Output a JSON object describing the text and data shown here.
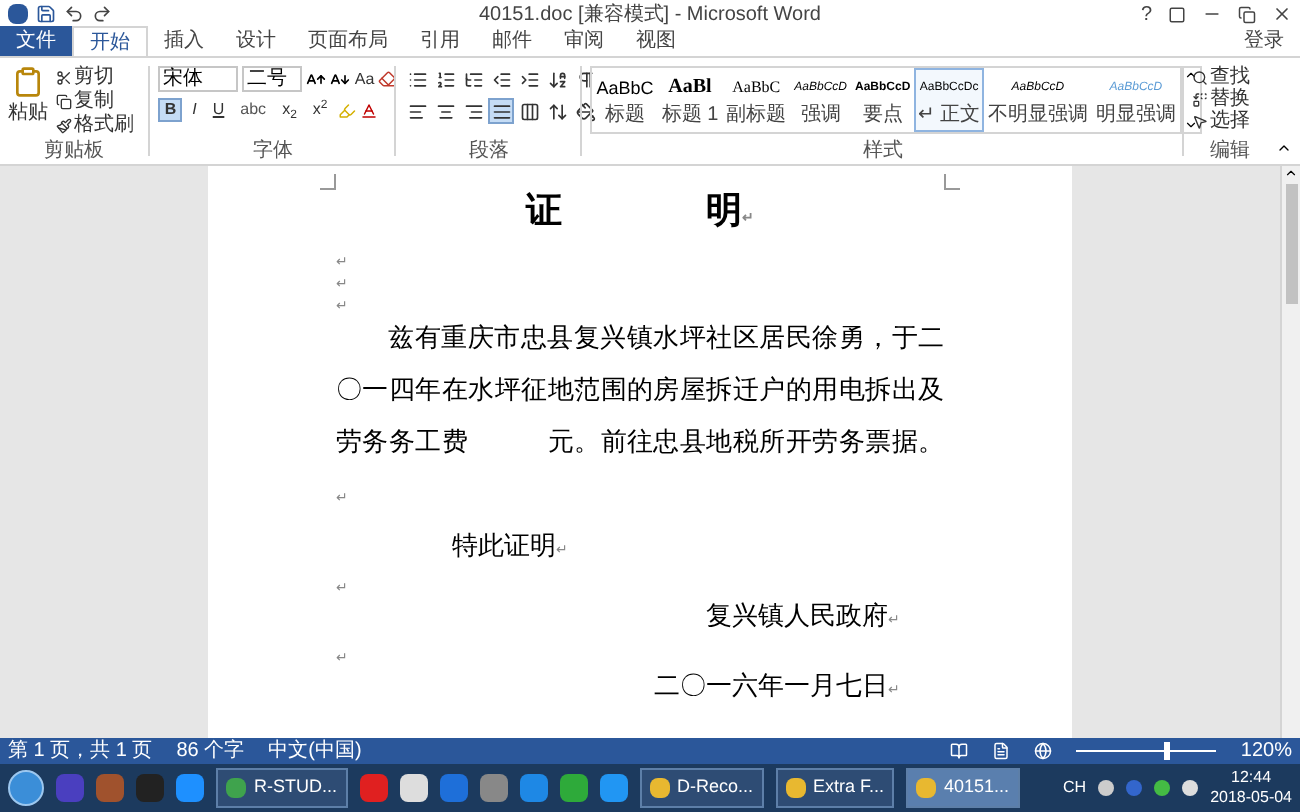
{
  "window": {
    "title": "40151.doc [兼容模式] - Microsoft Word",
    "help": "?",
    "signin": "登录"
  },
  "tabs": [
    {
      "label": "文件",
      "kind": "file",
      "selected": false
    },
    {
      "label": "开始",
      "kind": "tab",
      "selected": true
    },
    {
      "label": "插入",
      "kind": "tab",
      "selected": false
    },
    {
      "label": "设计",
      "kind": "tab",
      "selected": false
    },
    {
      "label": "页面布局",
      "kind": "tab",
      "selected": false
    },
    {
      "label": "引用",
      "kind": "tab",
      "selected": false
    },
    {
      "label": "邮件",
      "kind": "tab",
      "selected": false
    },
    {
      "label": "审阅",
      "kind": "tab",
      "selected": false
    },
    {
      "label": "视图",
      "kind": "tab",
      "selected": false
    }
  ],
  "clipboard": {
    "paste": "粘贴",
    "items": [
      "剪切",
      "复制",
      "格式刷"
    ],
    "label": "剪贴板"
  },
  "font": {
    "family": "宋体",
    "size": "二号",
    "change_case": "Aa",
    "formats": [
      {
        "label": "B",
        "kind": "bold",
        "selected": true
      },
      {
        "label": "I",
        "kind": "italic",
        "selected": false
      },
      {
        "label": "U",
        "kind": "underline",
        "selected": false
      },
      {
        "label": "abc",
        "kind": "strike",
        "selected": false
      },
      {
        "label": "x$_{2}$",
        "kind": "plain",
        "selected": false
      },
      {
        "label": "x$^{2}$",
        "kind": "plain",
        "selected": false
      }
    ],
    "label": "字体"
  },
  "paragraph": {
    "alignment": [
      {
        "kind": "left",
        "selected": false
      },
      {
        "kind": "center",
        "selected": false
      },
      {
        "kind": "right",
        "selected": false
      },
      {
        "kind": "justify",
        "selected": true
      },
      {
        "kind": "distribute",
        "selected": false
      }
    ],
    "label": "段落"
  },
  "styles": {
    "items": [
      {
        "sample": "AaBbC",
        "label": "标题",
        "kind": "title",
        "selected": false
      },
      {
        "sample": "AaBl",
        "label": "标题 1",
        "kind": "heading",
        "selected": false
      },
      {
        "sample": "AaBbC",
        "label": "副标题",
        "kind": "subtitle",
        "selected": false
      },
      {
        "sample": "AaBbCcD",
        "label": "强调",
        "kind": "emphasis",
        "selected": false
      },
      {
        "sample": "AaBbCcD",
        "label": "要点",
        "kind": "strong",
        "selected": false
      },
      {
        "sample": "AaBbCcDc",
        "label": "↵ 正文",
        "kind": "normal",
        "selected": true
      },
      {
        "sample": "AaBbCcD",
        "label": "不明显强调",
        "kind": "emphasis",
        "selected": false
      },
      {
        "sample": "AaBbCcD",
        "label": "明显强调",
        "kind": "intense",
        "selected": false
      }
    ],
    "label": "样式"
  },
  "editing": {
    "items": [
      "查找",
      "替换",
      "选择"
    ],
    "label": "编辑"
  },
  "document": {
    "paragraphs": [
      {
        "kind": "title",
        "text": "证　　　　明",
        "mark": "↵"
      },
      {
        "kind": "blank",
        "mark": "↵"
      },
      {
        "kind": "blank",
        "mark": "↵"
      },
      {
        "kind": "blank",
        "mark": "↵"
      },
      {
        "kind": "body",
        "text": "兹有重庆市忠县复兴镇水坪社区居民徐勇，于二〇一四年在水坪征地范围的房屋拆迁户的用电拆出及劳务务工费　　　元。前往忠县地税所开劳务票据。",
        "mark": "↵"
      },
      {
        "kind": "indent",
        "text": "特此证明",
        "mark": "↵"
      },
      {
        "kind": "blank",
        "mark": "↵"
      },
      {
        "kind": "right",
        "text": "复兴镇人民政府",
        "mark": "↵"
      },
      {
        "kind": "blank",
        "mark": "↵"
      },
      {
        "kind": "right",
        "text": "二〇一六年一月七日",
        "mark": "↵"
      }
    ]
  },
  "status_bar": {
    "page": "第 1 页，共 1 页",
    "words": "86 个字",
    "language": "中文(中国)",
    "zoom": "120%",
    "level": 0.62
  },
  "taskbar": {
    "tasks": [
      {
        "label": "R-STUD...",
        "selected": false
      },
      {
        "label": "D-Reco...",
        "selected": false
      },
      {
        "label": "Extra F...",
        "selected": false
      },
      {
        "label": "40151...",
        "selected": true
      }
    ],
    "tray": {
      "lang": "CH",
      "time": "12:44",
      "date": "2018-05-04"
    }
  }
}
